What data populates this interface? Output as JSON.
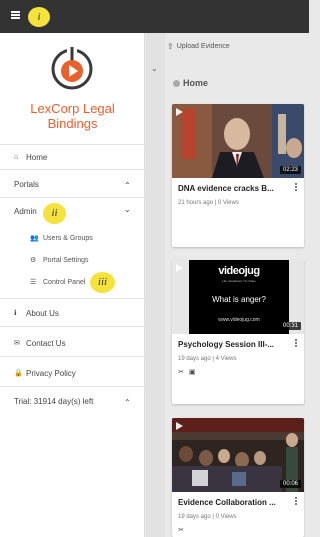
{
  "topbar": {
    "menu_icon": "hamburger-icon"
  },
  "markers": {
    "m1": "i",
    "m2": "ii",
    "m3": "iii"
  },
  "sidebar": {
    "brand_line1": "LexCorp Legal",
    "brand_line2": "Bindings",
    "home": "Home",
    "portals": "Portals",
    "admin": "Admin",
    "users_groups": "Users & Groups",
    "portal_settings": "Portal Settings",
    "control_panel": "Control Panel",
    "about_us": "About Us",
    "contact_us": "Contact Us",
    "privacy_policy": "Privacy Policy",
    "trial": "Trial: 31914 day(s) left"
  },
  "content": {
    "upload_label": "Upload Evidence",
    "home_header": "Home",
    "videos": [
      {
        "title": "DNA evidence cracks B...",
        "duration": "02:23",
        "meta": "21 hours ago  |  0 Views"
      },
      {
        "title": "Psychology Session III-...",
        "duration": "00:31",
        "meta": "19 days ago  |  4 Views",
        "brand": "videojug",
        "brand_sub": "Life. Explained. On Video",
        "question": "What is anger?",
        "url": "www.videojug.com"
      },
      {
        "title": "Evidence Collaboration ...",
        "duration": "00:06",
        "meta": "19 days ago  |  0 Views"
      }
    ]
  },
  "colors": {
    "topbar": "#333333",
    "brand": "#e8612c",
    "marker": "#f5e23c"
  }
}
